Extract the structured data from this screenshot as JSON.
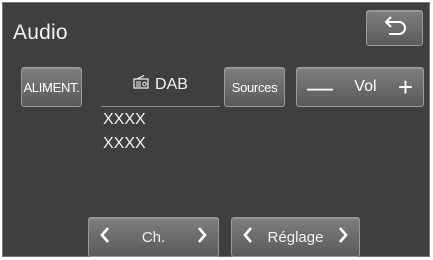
{
  "header": {
    "title": "Audio",
    "back_icon": "back-arrow-icon"
  },
  "controls": {
    "power_label": "ALIMENT.",
    "source_label": "DAB",
    "source_icon": "radio-icon",
    "sources_label": "Sources",
    "volume": {
      "minus": "—",
      "label": "Vol",
      "plus": "+"
    }
  },
  "station": {
    "line1": "XXXX",
    "line2": "XXXX"
  },
  "footer": {
    "channel": {
      "prev": "‹",
      "label": "Ch.",
      "next": "›"
    },
    "tuning": {
      "prev": "‹",
      "label": "Réglage",
      "next": "›"
    }
  }
}
